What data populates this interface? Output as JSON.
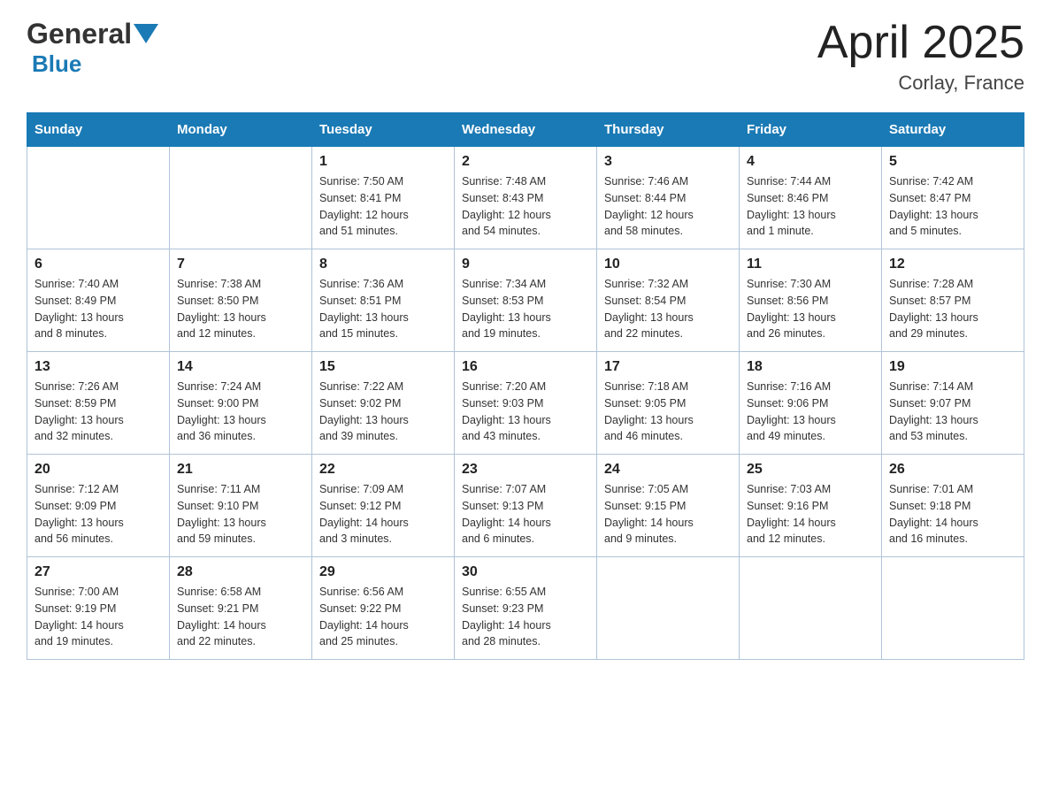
{
  "header": {
    "title": "April 2025",
    "subtitle": "Corlay, France"
  },
  "logo": {
    "general": "General",
    "blue": "Blue"
  },
  "weekdays": [
    "Sunday",
    "Monday",
    "Tuesday",
    "Wednesday",
    "Thursday",
    "Friday",
    "Saturday"
  ],
  "weeks": [
    [
      {
        "day": "",
        "info": ""
      },
      {
        "day": "",
        "info": ""
      },
      {
        "day": "1",
        "info": "Sunrise: 7:50 AM\nSunset: 8:41 PM\nDaylight: 12 hours\nand 51 minutes."
      },
      {
        "day": "2",
        "info": "Sunrise: 7:48 AM\nSunset: 8:43 PM\nDaylight: 12 hours\nand 54 minutes."
      },
      {
        "day": "3",
        "info": "Sunrise: 7:46 AM\nSunset: 8:44 PM\nDaylight: 12 hours\nand 58 minutes."
      },
      {
        "day": "4",
        "info": "Sunrise: 7:44 AM\nSunset: 8:46 PM\nDaylight: 13 hours\nand 1 minute."
      },
      {
        "day": "5",
        "info": "Sunrise: 7:42 AM\nSunset: 8:47 PM\nDaylight: 13 hours\nand 5 minutes."
      }
    ],
    [
      {
        "day": "6",
        "info": "Sunrise: 7:40 AM\nSunset: 8:49 PM\nDaylight: 13 hours\nand 8 minutes."
      },
      {
        "day": "7",
        "info": "Sunrise: 7:38 AM\nSunset: 8:50 PM\nDaylight: 13 hours\nand 12 minutes."
      },
      {
        "day": "8",
        "info": "Sunrise: 7:36 AM\nSunset: 8:51 PM\nDaylight: 13 hours\nand 15 minutes."
      },
      {
        "day": "9",
        "info": "Sunrise: 7:34 AM\nSunset: 8:53 PM\nDaylight: 13 hours\nand 19 minutes."
      },
      {
        "day": "10",
        "info": "Sunrise: 7:32 AM\nSunset: 8:54 PM\nDaylight: 13 hours\nand 22 minutes."
      },
      {
        "day": "11",
        "info": "Sunrise: 7:30 AM\nSunset: 8:56 PM\nDaylight: 13 hours\nand 26 minutes."
      },
      {
        "day": "12",
        "info": "Sunrise: 7:28 AM\nSunset: 8:57 PM\nDaylight: 13 hours\nand 29 minutes."
      }
    ],
    [
      {
        "day": "13",
        "info": "Sunrise: 7:26 AM\nSunset: 8:59 PM\nDaylight: 13 hours\nand 32 minutes."
      },
      {
        "day": "14",
        "info": "Sunrise: 7:24 AM\nSunset: 9:00 PM\nDaylight: 13 hours\nand 36 minutes."
      },
      {
        "day": "15",
        "info": "Sunrise: 7:22 AM\nSunset: 9:02 PM\nDaylight: 13 hours\nand 39 minutes."
      },
      {
        "day": "16",
        "info": "Sunrise: 7:20 AM\nSunset: 9:03 PM\nDaylight: 13 hours\nand 43 minutes."
      },
      {
        "day": "17",
        "info": "Sunrise: 7:18 AM\nSunset: 9:05 PM\nDaylight: 13 hours\nand 46 minutes."
      },
      {
        "day": "18",
        "info": "Sunrise: 7:16 AM\nSunset: 9:06 PM\nDaylight: 13 hours\nand 49 minutes."
      },
      {
        "day": "19",
        "info": "Sunrise: 7:14 AM\nSunset: 9:07 PM\nDaylight: 13 hours\nand 53 minutes."
      }
    ],
    [
      {
        "day": "20",
        "info": "Sunrise: 7:12 AM\nSunset: 9:09 PM\nDaylight: 13 hours\nand 56 minutes."
      },
      {
        "day": "21",
        "info": "Sunrise: 7:11 AM\nSunset: 9:10 PM\nDaylight: 13 hours\nand 59 minutes."
      },
      {
        "day": "22",
        "info": "Sunrise: 7:09 AM\nSunset: 9:12 PM\nDaylight: 14 hours\nand 3 minutes."
      },
      {
        "day": "23",
        "info": "Sunrise: 7:07 AM\nSunset: 9:13 PM\nDaylight: 14 hours\nand 6 minutes."
      },
      {
        "day": "24",
        "info": "Sunrise: 7:05 AM\nSunset: 9:15 PM\nDaylight: 14 hours\nand 9 minutes."
      },
      {
        "day": "25",
        "info": "Sunrise: 7:03 AM\nSunset: 9:16 PM\nDaylight: 14 hours\nand 12 minutes."
      },
      {
        "day": "26",
        "info": "Sunrise: 7:01 AM\nSunset: 9:18 PM\nDaylight: 14 hours\nand 16 minutes."
      }
    ],
    [
      {
        "day": "27",
        "info": "Sunrise: 7:00 AM\nSunset: 9:19 PM\nDaylight: 14 hours\nand 19 minutes."
      },
      {
        "day": "28",
        "info": "Sunrise: 6:58 AM\nSunset: 9:21 PM\nDaylight: 14 hours\nand 22 minutes."
      },
      {
        "day": "29",
        "info": "Sunrise: 6:56 AM\nSunset: 9:22 PM\nDaylight: 14 hours\nand 25 minutes."
      },
      {
        "day": "30",
        "info": "Sunrise: 6:55 AM\nSunset: 9:23 PM\nDaylight: 14 hours\nand 28 minutes."
      },
      {
        "day": "",
        "info": ""
      },
      {
        "day": "",
        "info": ""
      },
      {
        "day": "",
        "info": ""
      }
    ]
  ]
}
